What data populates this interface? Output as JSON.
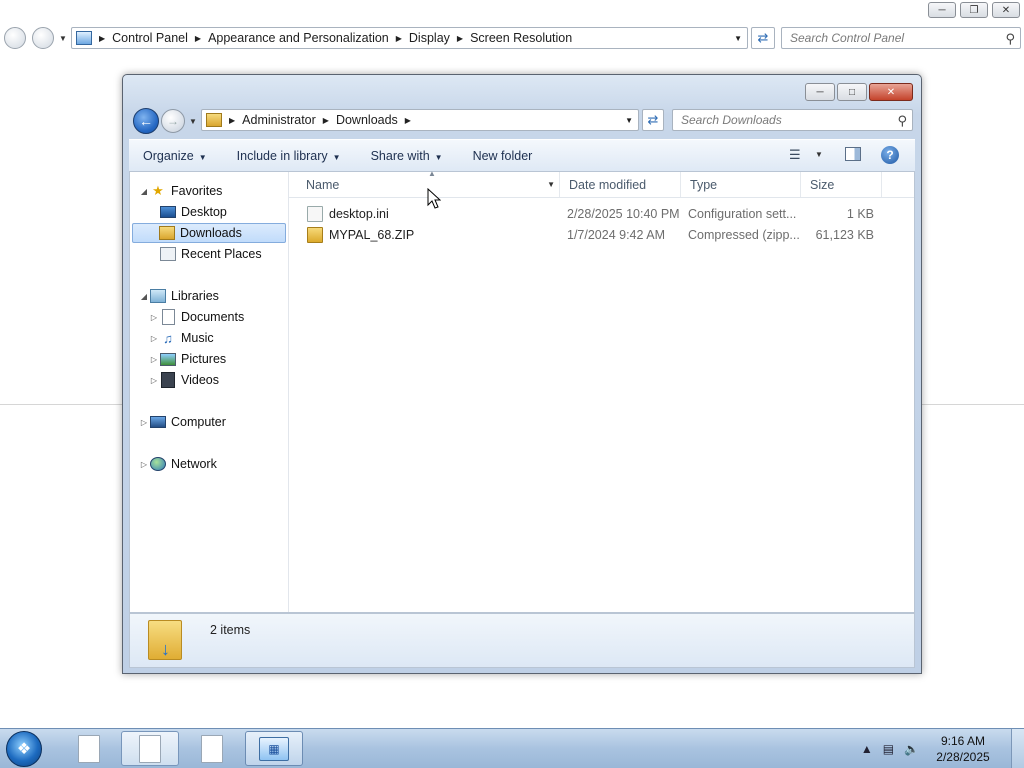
{
  "control_panel": {
    "breadcrumb": [
      "Control Panel",
      "Appearance and Personalization",
      "Display",
      "Screen Resolution"
    ],
    "search_placeholder": "Search Control Panel"
  },
  "explorer": {
    "breadcrumb": [
      "Administrator",
      "Downloads"
    ],
    "search_placeholder": "Search Downloads",
    "toolbar": {
      "organize": "Organize",
      "include_in_library": "Include in library",
      "share_with": "Share with",
      "new_folder": "New folder"
    },
    "nav": {
      "favorites": "Favorites",
      "desktop": "Desktop",
      "downloads": "Downloads",
      "recent_places": "Recent Places",
      "libraries": "Libraries",
      "documents": "Documents",
      "music": "Music",
      "pictures": "Pictures",
      "videos": "Videos",
      "computer": "Computer",
      "network": "Network"
    },
    "columns": {
      "name": "Name",
      "date_modified": "Date modified",
      "type": "Type",
      "size": "Size"
    },
    "files": [
      {
        "name": "desktop.ini",
        "date": "2/28/2025 10:40 PM",
        "type": "Configuration sett...",
        "size": "1 KB",
        "icon": "ini-file-icon"
      },
      {
        "name": "MYPAL_68.ZIP",
        "date": "1/7/2024 9:42 AM",
        "type": "Compressed (zipp...",
        "size": "61,123 KB",
        "icon": "zip-folder-icon"
      }
    ],
    "status": "2 items"
  },
  "taskbar": {
    "time": "9:16 AM",
    "date": "2/28/2025"
  },
  "colors": {
    "selection": "#c1dcfb",
    "window_frame": "#bfd0e6",
    "taskbar": "#a9c3e0"
  }
}
